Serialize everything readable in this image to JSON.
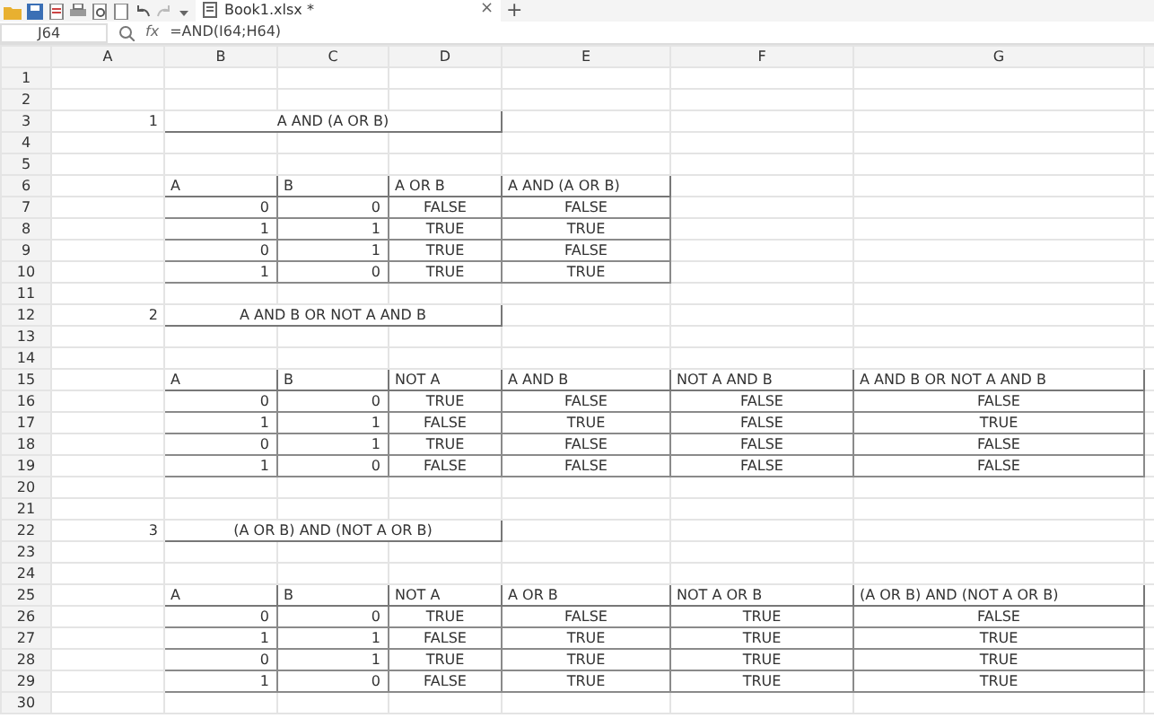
{
  "toolbar": {
    "tab": {
      "title": "Book1.xlsx *",
      "selected": true
    },
    "close": "×",
    "new_tab": "+"
  },
  "formula_bar": {
    "name_box": "J64",
    "fx": "fx",
    "formula": "=AND(I64;H64)"
  },
  "columns": [
    "A",
    "B",
    "C",
    "D",
    "E",
    "F",
    "G"
  ],
  "row_numbers": [
    "1",
    "2",
    "3",
    "4",
    "5",
    "6",
    "7",
    "8",
    "9",
    "10",
    "11",
    "12",
    "13",
    "14",
    "15",
    "16",
    "17",
    "18",
    "19",
    "20",
    "21",
    "22",
    "23",
    "24",
    "25",
    "26",
    "27",
    "28",
    "29",
    "30"
  ],
  "tasks": [
    {
      "number": "1",
      "title": "A AND (A OR B)",
      "header": [
        "A",
        "B",
        "A OR B",
        "A AND (A OR B)"
      ],
      "rows": [
        [
          "0",
          "0",
          "FALSE",
          "FALSE"
        ],
        [
          "1",
          "1",
          "TRUE",
          "TRUE"
        ],
        [
          "0",
          "1",
          "TRUE",
          "FALSE"
        ],
        [
          "1",
          "0",
          "TRUE",
          "TRUE"
        ]
      ]
    },
    {
      "number": "2",
      "title": "A AND B OR NOT A AND B",
      "header": [
        "A",
        "B",
        "NOT A",
        "A AND B",
        "NOT A AND B",
        "A AND B OR NOT A AND B"
      ],
      "rows": [
        [
          "0",
          "0",
          "TRUE",
          "FALSE",
          "FALSE",
          "FALSE"
        ],
        [
          "1",
          "1",
          "FALSE",
          "TRUE",
          "FALSE",
          "TRUE"
        ],
        [
          "0",
          "1",
          "TRUE",
          "FALSE",
          "FALSE",
          "FALSE"
        ],
        [
          "1",
          "0",
          "FALSE",
          "FALSE",
          "FALSE",
          "FALSE"
        ]
      ]
    },
    {
      "number": "3",
      "title": "(A OR B) AND (NOT A OR B)",
      "header": [
        "A",
        "B",
        "NOT A",
        "A OR B",
        "NOT A OR B",
        "(A OR B) AND (NOT A OR B)"
      ],
      "rows": [
        [
          "0",
          "0",
          "TRUE",
          "FALSE",
          "TRUE",
          "FALSE"
        ],
        [
          "1",
          "1",
          "FALSE",
          "TRUE",
          "TRUE",
          "TRUE"
        ],
        [
          "0",
          "1",
          "TRUE",
          "TRUE",
          "TRUE",
          "TRUE"
        ],
        [
          "1",
          "0",
          "FALSE",
          "TRUE",
          "TRUE",
          "TRUE"
        ]
      ]
    }
  ]
}
